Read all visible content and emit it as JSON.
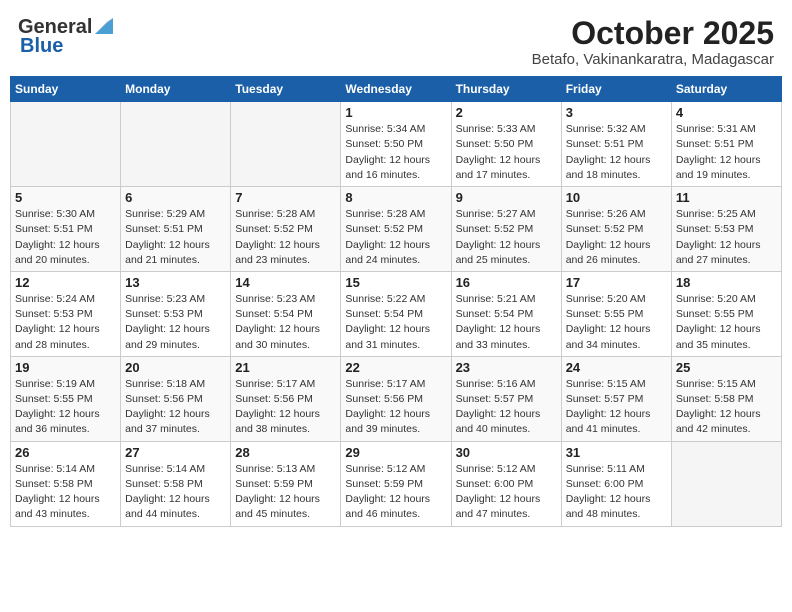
{
  "header": {
    "logo_line1": "General",
    "logo_line2": "Blue",
    "month_title": "October 2025",
    "location": "Betafo, Vakinankaratra, Madagascar"
  },
  "days_of_week": [
    "Sunday",
    "Monday",
    "Tuesday",
    "Wednesday",
    "Thursday",
    "Friday",
    "Saturday"
  ],
  "weeks": [
    [
      {
        "num": "",
        "info": ""
      },
      {
        "num": "",
        "info": ""
      },
      {
        "num": "",
        "info": ""
      },
      {
        "num": "1",
        "info": "Sunrise: 5:34 AM\nSunset: 5:50 PM\nDaylight: 12 hours\nand 16 minutes."
      },
      {
        "num": "2",
        "info": "Sunrise: 5:33 AM\nSunset: 5:50 PM\nDaylight: 12 hours\nand 17 minutes."
      },
      {
        "num": "3",
        "info": "Sunrise: 5:32 AM\nSunset: 5:51 PM\nDaylight: 12 hours\nand 18 minutes."
      },
      {
        "num": "4",
        "info": "Sunrise: 5:31 AM\nSunset: 5:51 PM\nDaylight: 12 hours\nand 19 minutes."
      }
    ],
    [
      {
        "num": "5",
        "info": "Sunrise: 5:30 AM\nSunset: 5:51 PM\nDaylight: 12 hours\nand 20 minutes."
      },
      {
        "num": "6",
        "info": "Sunrise: 5:29 AM\nSunset: 5:51 PM\nDaylight: 12 hours\nand 21 minutes."
      },
      {
        "num": "7",
        "info": "Sunrise: 5:28 AM\nSunset: 5:52 PM\nDaylight: 12 hours\nand 23 minutes."
      },
      {
        "num": "8",
        "info": "Sunrise: 5:28 AM\nSunset: 5:52 PM\nDaylight: 12 hours\nand 24 minutes."
      },
      {
        "num": "9",
        "info": "Sunrise: 5:27 AM\nSunset: 5:52 PM\nDaylight: 12 hours\nand 25 minutes."
      },
      {
        "num": "10",
        "info": "Sunrise: 5:26 AM\nSunset: 5:52 PM\nDaylight: 12 hours\nand 26 minutes."
      },
      {
        "num": "11",
        "info": "Sunrise: 5:25 AM\nSunset: 5:53 PM\nDaylight: 12 hours\nand 27 minutes."
      }
    ],
    [
      {
        "num": "12",
        "info": "Sunrise: 5:24 AM\nSunset: 5:53 PM\nDaylight: 12 hours\nand 28 minutes."
      },
      {
        "num": "13",
        "info": "Sunrise: 5:23 AM\nSunset: 5:53 PM\nDaylight: 12 hours\nand 29 minutes."
      },
      {
        "num": "14",
        "info": "Sunrise: 5:23 AM\nSunset: 5:54 PM\nDaylight: 12 hours\nand 30 minutes."
      },
      {
        "num": "15",
        "info": "Sunrise: 5:22 AM\nSunset: 5:54 PM\nDaylight: 12 hours\nand 31 minutes."
      },
      {
        "num": "16",
        "info": "Sunrise: 5:21 AM\nSunset: 5:54 PM\nDaylight: 12 hours\nand 33 minutes."
      },
      {
        "num": "17",
        "info": "Sunrise: 5:20 AM\nSunset: 5:55 PM\nDaylight: 12 hours\nand 34 minutes."
      },
      {
        "num": "18",
        "info": "Sunrise: 5:20 AM\nSunset: 5:55 PM\nDaylight: 12 hours\nand 35 minutes."
      }
    ],
    [
      {
        "num": "19",
        "info": "Sunrise: 5:19 AM\nSunset: 5:55 PM\nDaylight: 12 hours\nand 36 minutes."
      },
      {
        "num": "20",
        "info": "Sunrise: 5:18 AM\nSunset: 5:56 PM\nDaylight: 12 hours\nand 37 minutes."
      },
      {
        "num": "21",
        "info": "Sunrise: 5:17 AM\nSunset: 5:56 PM\nDaylight: 12 hours\nand 38 minutes."
      },
      {
        "num": "22",
        "info": "Sunrise: 5:17 AM\nSunset: 5:56 PM\nDaylight: 12 hours\nand 39 minutes."
      },
      {
        "num": "23",
        "info": "Sunrise: 5:16 AM\nSunset: 5:57 PM\nDaylight: 12 hours\nand 40 minutes."
      },
      {
        "num": "24",
        "info": "Sunrise: 5:15 AM\nSunset: 5:57 PM\nDaylight: 12 hours\nand 41 minutes."
      },
      {
        "num": "25",
        "info": "Sunrise: 5:15 AM\nSunset: 5:58 PM\nDaylight: 12 hours\nand 42 minutes."
      }
    ],
    [
      {
        "num": "26",
        "info": "Sunrise: 5:14 AM\nSunset: 5:58 PM\nDaylight: 12 hours\nand 43 minutes."
      },
      {
        "num": "27",
        "info": "Sunrise: 5:14 AM\nSunset: 5:58 PM\nDaylight: 12 hours\nand 44 minutes."
      },
      {
        "num": "28",
        "info": "Sunrise: 5:13 AM\nSunset: 5:59 PM\nDaylight: 12 hours\nand 45 minutes."
      },
      {
        "num": "29",
        "info": "Sunrise: 5:12 AM\nSunset: 5:59 PM\nDaylight: 12 hours\nand 46 minutes."
      },
      {
        "num": "30",
        "info": "Sunrise: 5:12 AM\nSunset: 6:00 PM\nDaylight: 12 hours\nand 47 minutes."
      },
      {
        "num": "31",
        "info": "Sunrise: 5:11 AM\nSunset: 6:00 PM\nDaylight: 12 hours\nand 48 minutes."
      },
      {
        "num": "",
        "info": ""
      }
    ]
  ]
}
